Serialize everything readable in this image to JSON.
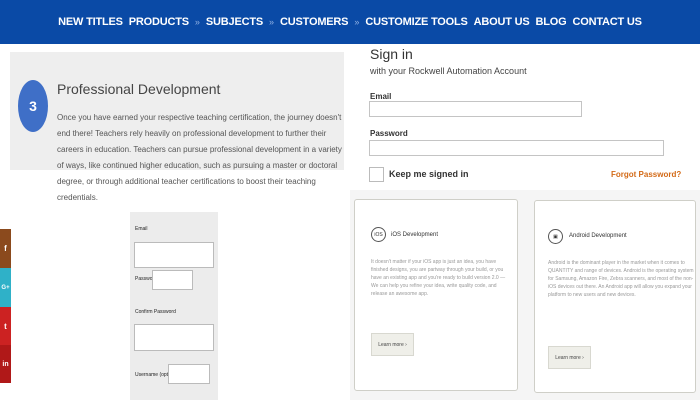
{
  "nav": {
    "items": [
      "NEW TITLES",
      "PRODUCTS",
      "SUBJECTS",
      "CUSTOMERS",
      "CUSTOMIZE TOOLS",
      "ABOUT US",
      "BLOG",
      "CONTACT US"
    ],
    "separator": "»",
    "bg_color": "#0a4aa6"
  },
  "pd": {
    "step": "3",
    "title": "Professional Development",
    "text": "Once you have earned your respective teaching certification, the journey doesn't end there! Teachers rely heavily on professional development to further their careers in education. Teachers can pursue professional development in a variety of ways, like continued higher education, such as pursuing a master or doctoral degree, or through additional teacher certifications to boost their teaching credentials."
  },
  "signin": {
    "title": "Sign in",
    "subtitle": "with your Rockwell Automation Account",
    "email_label": "Email",
    "email_value": "",
    "password_label": "Password",
    "password_value": "",
    "keep_label": "Keep me signed in",
    "forgot_label": "Forgot Password?",
    "accent_color": "#d36a17"
  },
  "social": [
    {
      "icon": "facebook-icon",
      "glyph": "f",
      "color": "#8b4a1d"
    },
    {
      "icon": "google-plus-icon",
      "glyph": "G+",
      "color": "#2fb1c8"
    },
    {
      "icon": "twitter-icon",
      "glyph": "t",
      "color": "#cc2222"
    },
    {
      "icon": "linkedin-icon",
      "glyph": "in",
      "color": "#b01818"
    }
  ],
  "register": {
    "email_label": "Email",
    "password_label": "Password",
    "confirm_label": "Confirm Password",
    "username_label": "Username (optional)"
  },
  "cards": [
    {
      "icon": "ios-icon",
      "icon_glyph": "iOS",
      "title": "iOS Development",
      "text": "It doesn't matter if your iOS app is just an idea, you have finished designs, you are partway through your build, or you have an existing app and you're ready to build version 2.0 — We can help you refine your idea, write quality code, and release an awesome app.",
      "button": "Learn more ›"
    },
    {
      "icon": "android-icon",
      "icon_glyph": "▣",
      "title": "Android Development",
      "text": "Android is the dominant player in the market when it comes to QUANTITY and range of devices. Android is the operating system for Samsung, Amazon Fire, Zebra scanners, and most of the non-iOS devices out there. An Android app will allow you expand your platform to new users and new devices.",
      "button": "Learn more ›"
    }
  ]
}
